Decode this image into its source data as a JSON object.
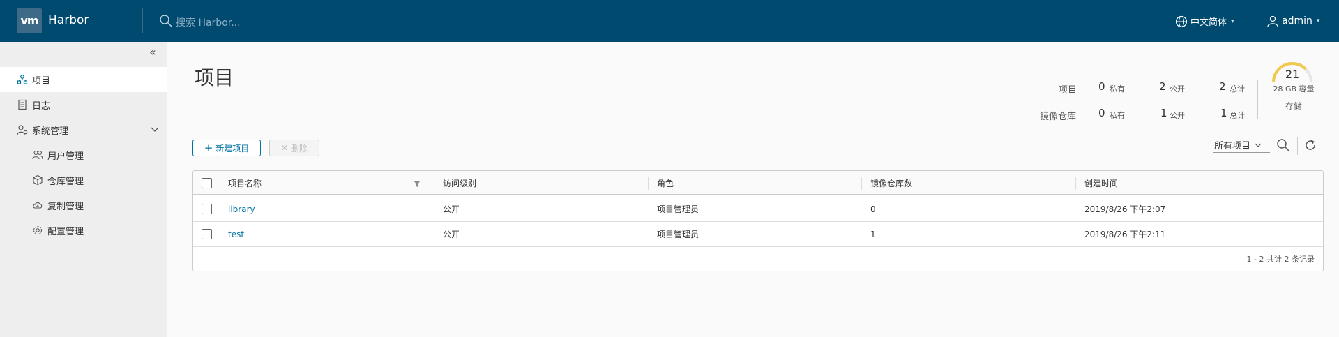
{
  "header": {
    "logo_text": "vm",
    "brand": "Harbor",
    "search_placeholder": "搜索 Harbor...",
    "language": "中文简体",
    "user": "admin",
    "bg_color": "#004a70"
  },
  "sidebar": {
    "items": [
      {
        "label": "项目",
        "icon": "projects-icon",
        "active": true
      },
      {
        "label": "日志",
        "icon": "log-icon"
      },
      {
        "label": "系统管理",
        "icon": "admin-icon"
      },
      {
        "label": "用户管理",
        "icon": "users-icon"
      },
      {
        "label": "仓库管理",
        "icon": "registry-icon"
      },
      {
        "label": "复制管理",
        "icon": "replication-icon"
      },
      {
        "label": "配置管理",
        "icon": "config-icon"
      }
    ]
  },
  "main": {
    "title": "项目",
    "stats": {
      "projects_label": "项目",
      "repos_label": "镜像仓库",
      "private_label": "私有",
      "public_label": "公开",
      "total_label": "总计",
      "projects": {
        "private": "0",
        "public": "2",
        "total": "2"
      },
      "repos": {
        "private": "0",
        "public": "1",
        "total": "1"
      }
    },
    "storage": {
      "value": "21",
      "capacity": "28 GB 容量",
      "label": "存储",
      "fill_fraction": 0.75,
      "color": "#f2c94c"
    },
    "toolbar": {
      "new_label": "新建项目",
      "delete_label": "删除",
      "filter_label": "所有项目"
    },
    "table": {
      "columns": [
        "项目名称",
        "访问级别",
        "角色",
        "镜像仓库数",
        "创建时间"
      ],
      "rows": [
        {
          "name": "library",
          "access": "公开",
          "role": "项目管理员",
          "repos": "0",
          "created": "2019/8/26 下午2:07"
        },
        {
          "name": "test",
          "access": "公开",
          "role": "项目管理员",
          "repos": "1",
          "created": "2019/8/26 下午2:11"
        }
      ],
      "footer": "1 - 2 共计 2 条记录"
    }
  }
}
